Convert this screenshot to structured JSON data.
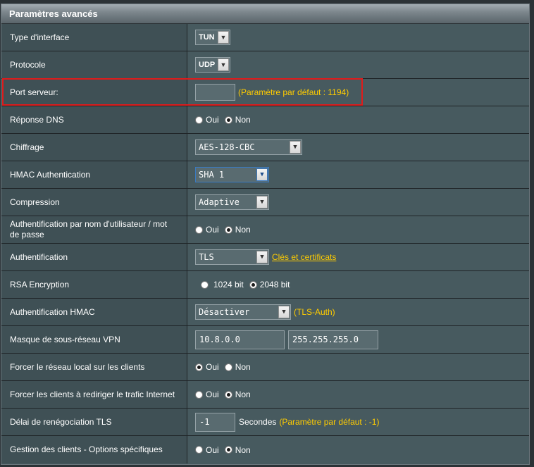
{
  "header": {
    "title": "Paramètres avancés"
  },
  "rows": {
    "interface_type": {
      "label": "Type d'interface",
      "value": "TUN"
    },
    "protocol": {
      "label": "Protocole",
      "value": "UDP"
    },
    "server_port": {
      "label": "Port serveur:",
      "value": "",
      "hint": "(Paramètre par défaut : 1194)"
    },
    "dns_response": {
      "label": "Réponse DNS",
      "options": [
        "Oui",
        "Non"
      ],
      "selected": "Non"
    },
    "cipher": {
      "label": "Chiffrage",
      "value": "AES-128-CBC"
    },
    "hmac_auth": {
      "label": "HMAC Authentication",
      "value": "SHA 1"
    },
    "compression": {
      "label": "Compression",
      "value": "Adaptive"
    },
    "user_pass_auth": {
      "label": "Authentification par nom d'utilisateur / mot de passe",
      "options": [
        "Oui",
        "Non"
      ],
      "selected": "Non"
    },
    "authentication": {
      "label": "Authentification",
      "value": "TLS",
      "link": "Clés et certificats"
    },
    "rsa": {
      "label": "RSA Encryption",
      "options": [
        "1024 bit",
        "2048 bit"
      ],
      "selected": "2048 bit"
    },
    "hmac_auth2": {
      "label": "Authentification HMAC",
      "value": "Désactiver",
      "hint": "(TLS-Auth)"
    },
    "vpn_subnet": {
      "label": "Masque de sous-réseau VPN",
      "network": "10.8.0.0",
      "mask": "255.255.255.0"
    },
    "push_lan": {
      "label": "Forcer le réseau local sur les clients",
      "options": [
        "Oui",
        "Non"
      ],
      "selected": "Oui"
    },
    "redirect_gateway": {
      "label": "Forcer les clients à rediriger le trafic Internet",
      "options": [
        "Oui",
        "Non"
      ],
      "selected": "Non"
    },
    "tls_reneg": {
      "label": "Délai de renégociation TLS",
      "value": "-1",
      "unit": "Secondes",
      "hint": "(Paramètre par défaut : -1)"
    },
    "client_specific": {
      "label": "Gestion des clients - Options spécifiques",
      "options": [
        "Oui",
        "Non"
      ],
      "selected": "Non"
    }
  },
  "colors": {
    "hint": "#ffcc00",
    "highlight": "#e01b1b",
    "label_bg": "#3f5055",
    "value_bg": "#475a5f"
  }
}
